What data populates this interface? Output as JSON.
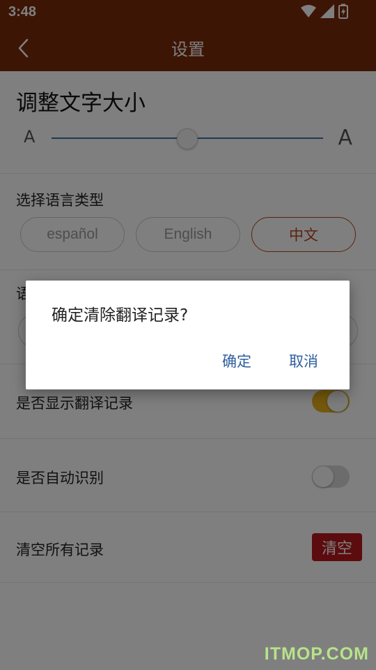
{
  "status_bar": {
    "time": "3:48",
    "icons": [
      "wifi-icon",
      "signal-icon",
      "battery-charging-icon"
    ]
  },
  "app_bar": {
    "title": "设置",
    "back_icon": "chevron-left-icon",
    "color": "#7a2a0a"
  },
  "font_size": {
    "heading": "调整文字大小",
    "small_label": "A",
    "large_label": "A",
    "slider_level": 0.5,
    "accent": "#3d6fb0"
  },
  "language": {
    "heading": "选择语言类型",
    "options": [
      "español",
      "English",
      "中文"
    ],
    "selected": "中文",
    "accent": "#b3461c"
  },
  "partial_section_label": "语",
  "settings": {
    "show_history_label": "是否显示翻译记录",
    "show_history_on": true,
    "auto_detect_label": "是否自动识别",
    "auto_detect_on": false,
    "clear_all_label": "清空所有记录",
    "clear_button_label": "清空",
    "clear_button_color": "#b8191f"
  },
  "dialog": {
    "message": "确定清除翻译记录?",
    "confirm_label": "确定",
    "cancel_label": "取消"
  },
  "watermark": "ITMOP.COM"
}
